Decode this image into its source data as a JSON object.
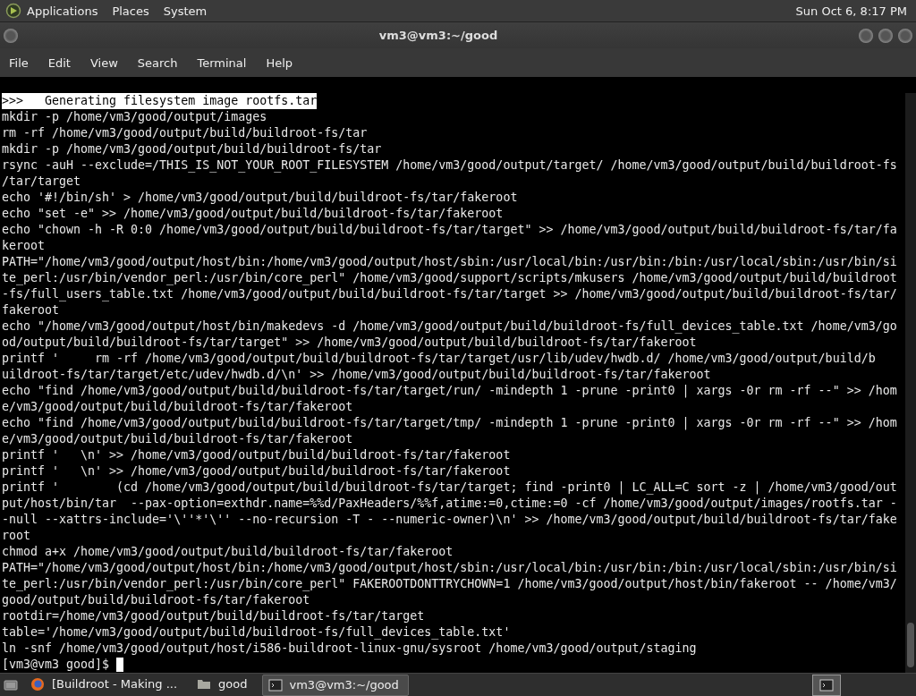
{
  "top_panel": {
    "menus": [
      "Applications",
      "Places",
      "System"
    ],
    "clock": "Sun Oct  6,  8:17 PM"
  },
  "window": {
    "title": "vm3@vm3:~/good",
    "menu": [
      "File",
      "Edit",
      "View",
      "Search",
      "Terminal",
      "Help"
    ]
  },
  "terminal": {
    "lines": [
      {
        "text": ">>>   Generating filesystem image rootfs.tar",
        "highlighted": true
      },
      {
        "text": "mkdir -p /home/vm3/good/output/images",
        "highlighted": false
      },
      {
        "text": "rm -rf /home/vm3/good/output/build/buildroot-fs/tar",
        "highlighted": false
      },
      {
        "text": "mkdir -p /home/vm3/good/output/build/buildroot-fs/tar",
        "highlighted": false
      },
      {
        "text": "rsync -auH --exclude=/THIS_IS_NOT_YOUR_ROOT_FILESYSTEM /home/vm3/good/output/target/ /home/vm3/good/output/build/buildroot-fs",
        "highlighted": false
      },
      {
        "text": "/tar/target",
        "highlighted": false
      },
      {
        "text": "echo '#!/bin/sh' > /home/vm3/good/output/build/buildroot-fs/tar/fakeroot",
        "highlighted": false
      },
      {
        "text": "echo \"set -e\" >> /home/vm3/good/output/build/buildroot-fs/tar/fakeroot",
        "highlighted": false
      },
      {
        "text": "echo \"chown -h -R 0:0 /home/vm3/good/output/build/buildroot-fs/tar/target\" >> /home/vm3/good/output/build/buildroot-fs/tar/fa",
        "highlighted": false
      },
      {
        "text": "keroot",
        "highlighted": false
      },
      {
        "text": "PATH=\"/home/vm3/good/output/host/bin:/home/vm3/good/output/host/sbin:/usr/local/bin:/usr/bin:/bin:/usr/local/sbin:/usr/bin/si",
        "highlighted": false
      },
      {
        "text": "te_perl:/usr/bin/vendor_perl:/usr/bin/core_perl\" /home/vm3/good/support/scripts/mkusers /home/vm3/good/output/build/buildroot",
        "highlighted": false
      },
      {
        "text": "-fs/full_users_table.txt /home/vm3/good/output/build/buildroot-fs/tar/target >> /home/vm3/good/output/build/buildroot-fs/tar/",
        "highlighted": false
      },
      {
        "text": "fakeroot",
        "highlighted": false
      },
      {
        "text": "echo \"/home/vm3/good/output/host/bin/makedevs -d /home/vm3/good/output/build/buildroot-fs/full_devices_table.txt /home/vm3/go",
        "highlighted": false
      },
      {
        "text": "od/output/build/buildroot-fs/tar/target\" >> /home/vm3/good/output/build/buildroot-fs/tar/fakeroot",
        "highlighted": false
      },
      {
        "text": "printf '     rm -rf /home/vm3/good/output/build/buildroot-fs/tar/target/usr/lib/udev/hwdb.d/ /home/vm3/good/output/build/b",
        "highlighted": false
      },
      {
        "text": "uildroot-fs/tar/target/etc/udev/hwdb.d/\\n' >> /home/vm3/good/output/build/buildroot-fs/tar/fakeroot",
        "highlighted": false
      },
      {
        "text": "echo \"find /home/vm3/good/output/build/buildroot-fs/tar/target/run/ -mindepth 1 -prune -print0 | xargs -0r rm -rf --\" >> /hom",
        "highlighted": false
      },
      {
        "text": "e/vm3/good/output/build/buildroot-fs/tar/fakeroot",
        "highlighted": false
      },
      {
        "text": "echo \"find /home/vm3/good/output/build/buildroot-fs/tar/target/tmp/ -mindepth 1 -prune -print0 | xargs -0r rm -rf --\" >> /hom",
        "highlighted": false
      },
      {
        "text": "e/vm3/good/output/build/buildroot-fs/tar/fakeroot",
        "highlighted": false
      },
      {
        "text": "printf '   \\n' >> /home/vm3/good/output/build/buildroot-fs/tar/fakeroot",
        "highlighted": false
      },
      {
        "text": "printf '   \\n' >> /home/vm3/good/output/build/buildroot-fs/tar/fakeroot",
        "highlighted": false
      },
      {
        "text": "printf '        (cd /home/vm3/good/output/build/buildroot-fs/tar/target; find -print0 | LC_ALL=C sort -z | /home/vm3/good/out",
        "highlighted": false
      },
      {
        "text": "put/host/bin/tar  --pax-option=exthdr.name=%%d/PaxHeaders/%%f,atime:=0,ctime:=0 -cf /home/vm3/good/output/images/rootfs.tar -",
        "highlighted": false
      },
      {
        "text": "-null --xattrs-include='\\''*'\\'' --no-recursion -T - --numeric-owner)\\n' >> /home/vm3/good/output/build/buildroot-fs/tar/fake",
        "highlighted": false
      },
      {
        "text": "root",
        "highlighted": false
      },
      {
        "text": "chmod a+x /home/vm3/good/output/build/buildroot-fs/tar/fakeroot",
        "highlighted": false
      },
      {
        "text": "PATH=\"/home/vm3/good/output/host/bin:/home/vm3/good/output/host/sbin:/usr/local/bin:/usr/bin:/bin:/usr/local/sbin:/usr/bin/si",
        "highlighted": false
      },
      {
        "text": "te_perl:/usr/bin/vendor_perl:/usr/bin/core_perl\" FAKEROOTDONTTRYCHOWN=1 /home/vm3/good/output/host/bin/fakeroot -- /home/vm3/",
        "highlighted": false
      },
      {
        "text": "good/output/build/buildroot-fs/tar/fakeroot",
        "highlighted": false
      },
      {
        "text": "rootdir=/home/vm3/good/output/build/buildroot-fs/tar/target",
        "highlighted": false
      },
      {
        "text": "table='/home/vm3/good/output/build/buildroot-fs/full_devices_table.txt'",
        "highlighted": false
      },
      {
        "text": "ln -snf /home/vm3/good/output/host/i586-buildroot-linux-gnu/sysroot /home/vm3/good/output/staging",
        "highlighted": false
      }
    ],
    "prompt": "[vm3@vm3 good]$"
  },
  "taskbar": {
    "tasks": [
      {
        "kind": "browser",
        "label": "[Buildroot - Making ...",
        "selected": false
      },
      {
        "kind": "folder",
        "label": "good",
        "selected": false
      },
      {
        "kind": "terminal",
        "label": "vm3@vm3:~/good",
        "selected": true
      }
    ]
  }
}
